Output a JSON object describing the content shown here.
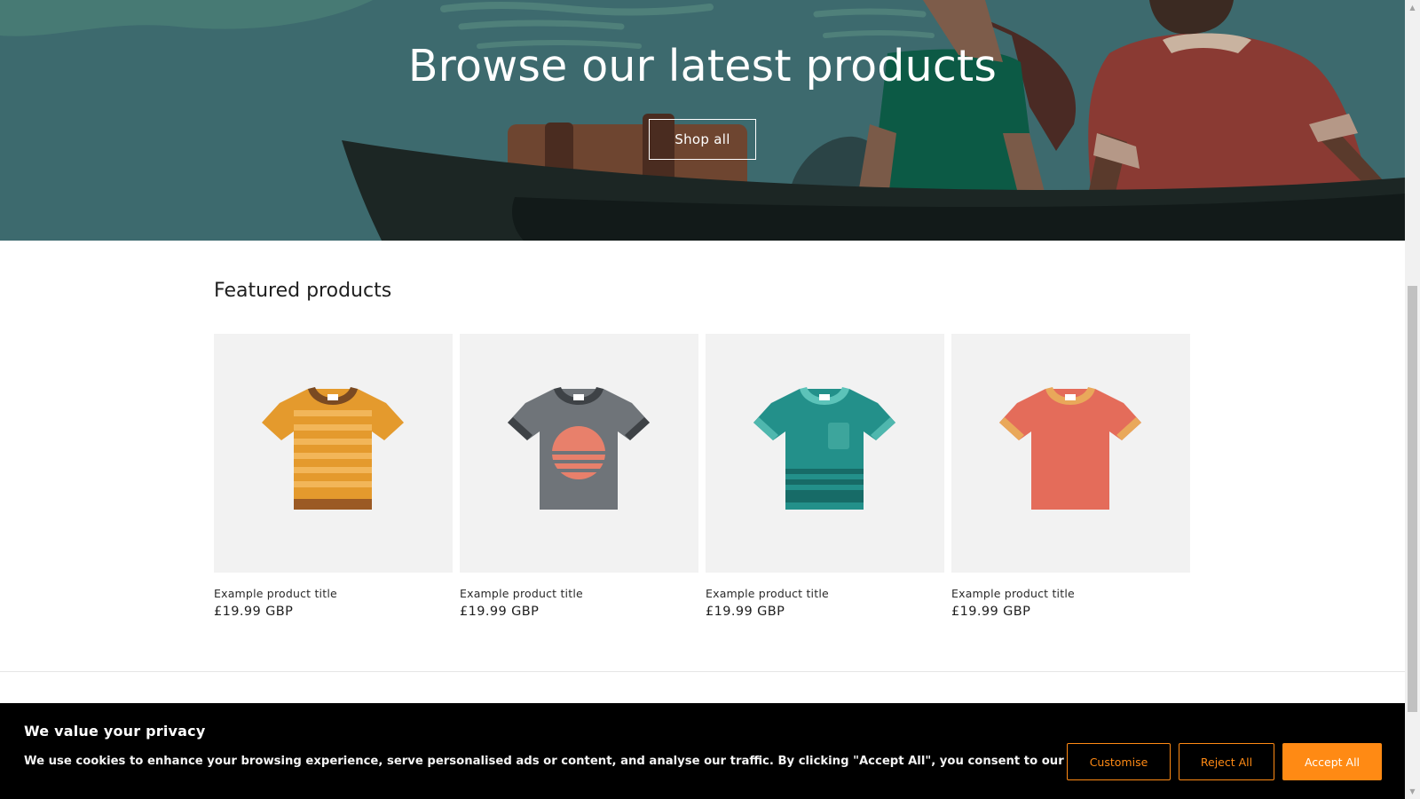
{
  "hero": {
    "title": "Browse our latest products",
    "button_label": "Shop all"
  },
  "featured": {
    "title": "Featured products",
    "products": [
      {
        "title": "Example product title",
        "price": "£19.99 GBP",
        "icon": "tshirt-icon",
        "color": "#e49a2d"
      },
      {
        "title": "Example product title",
        "price": "£19.99 GBP",
        "icon": "tshirt-icon",
        "color": "#6f7479"
      },
      {
        "title": "Example product title",
        "price": "£19.99 GBP",
        "icon": "tshirt-icon",
        "color": "#23908a"
      },
      {
        "title": "Example product title",
        "price": "£19.99 GBP",
        "icon": "tshirt-icon",
        "color": "#e46c5a"
      }
    ]
  },
  "cookie_banner": {
    "title": "We value your privacy",
    "text": "We use cookies to enhance your browsing experience, serve personalised ads or content, and analyse our traffic. By clicking \"Accept All\", you consent to our use of cookies.",
    "customise_label": "Customise",
    "reject_label": "Reject All",
    "accept_label": "Accept All",
    "accent_color": "#ff8a14"
  }
}
